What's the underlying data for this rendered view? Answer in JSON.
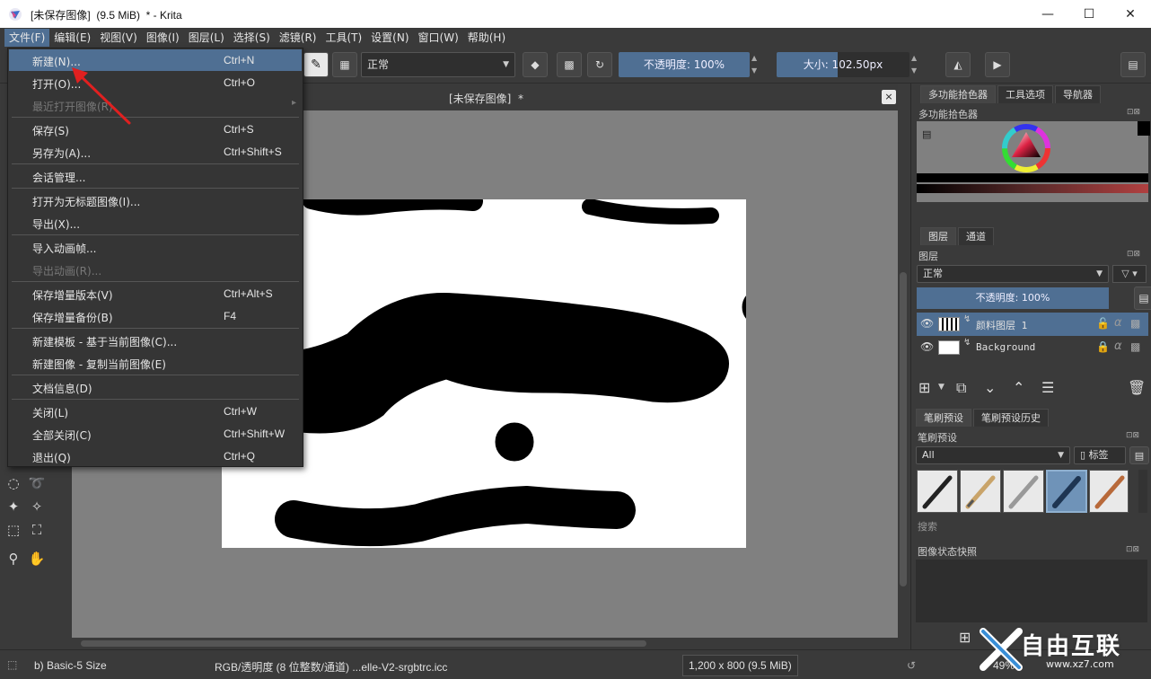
{
  "window": {
    "title": "[未保存图像]  (9.5 MiB)  * - Krita",
    "minimize_label": "—",
    "maximize_label": "☐",
    "close_label": "✕"
  },
  "menubar": {
    "items": [
      "文件(F)",
      "编辑(E)",
      "视图(V)",
      "图像(I)",
      "图层(L)",
      "选择(S)",
      "滤镜(R)",
      "工具(T)",
      "设置(N)",
      "窗口(W)",
      "帮助(H)"
    ],
    "active_index": 0
  },
  "toolbar": {
    "blend_mode": "正常",
    "opacity_label": "不透明度: 100%",
    "size_label": "大小: 102.50px"
  },
  "document": {
    "tab_title": "[未保存图像]  *",
    "close_label": "×"
  },
  "file_menu": {
    "items": [
      {
        "label": "新建(N)...",
        "shortcut": "Ctrl+N",
        "highlighted": true
      },
      {
        "label": "打开(O)...",
        "shortcut": "Ctrl+O"
      },
      {
        "label": "最近打开图像(R)",
        "shortcut": "",
        "disabled": true,
        "submenu": true
      },
      {
        "label": "保存(S)",
        "shortcut": "Ctrl+S"
      },
      {
        "label": "另存为(A)...",
        "shortcut": "Ctrl+Shift+S"
      },
      {
        "label": "会话管理...",
        "shortcut": ""
      },
      {
        "label": "打开为无标题图像(I)...",
        "shortcut": ""
      },
      {
        "label": "导出(X)...",
        "shortcut": ""
      },
      {
        "label": "导入动画帧...",
        "shortcut": ""
      },
      {
        "label": "导出动画(R)...",
        "shortcut": "",
        "disabled": true
      },
      {
        "label": "保存增量版本(V)",
        "shortcut": "Ctrl+Alt+S"
      },
      {
        "label": "保存增量备份(B)",
        "shortcut": "F4"
      },
      {
        "label": "新建模板 - 基于当前图像(C)...",
        "shortcut": ""
      },
      {
        "label": "新建图像 - 复制当前图像(E)",
        "shortcut": ""
      },
      {
        "label": "文档信息(D)",
        "shortcut": ""
      },
      {
        "label": "关闭(L)",
        "shortcut": "Ctrl+W"
      },
      {
        "label": "全部关闭(C)",
        "shortcut": "Ctrl+Shift+W"
      },
      {
        "label": "退出(Q)",
        "shortcut": "Ctrl+Q"
      }
    ]
  },
  "dock": {
    "top_tabs": [
      "多功能拾色器",
      "工具选项",
      "导航器"
    ],
    "color_panel_title": "多功能拾色器",
    "layer_tabs": [
      "图层",
      "通道"
    ],
    "layers_title": "图层",
    "layer_blend_mode": "正常",
    "layer_opacity": "不透明度:  100%",
    "layers": [
      {
        "name": "颜料图层  1",
        "selected": true
      },
      {
        "name": "Background",
        "selected": false
      }
    ],
    "brush_tabs": [
      "笔刷预设",
      "笔刷预设历史"
    ],
    "brush_panel_title": "笔刷预设",
    "brush_filter": "All",
    "brush_tag_label": "标签",
    "brush_search": "搜索",
    "snapshot_title": "图像状态快照"
  },
  "statusbar": {
    "brush_name": "b) Basic-5 Size",
    "color_profile": "RGB/透明度 (8 位整数/通道)  ...elle-V2-srgbtrc.icc",
    "dimensions": "1,200 x 800 (9.5 MiB)",
    "zoom": "49%"
  },
  "watermark": {
    "text": "自由互联",
    "url": "www.xz7.com"
  },
  "colors": {
    "accent": "#4f6f93",
    "panel_bg": "#3a3a3a",
    "canvas_bg": "#808080"
  }
}
